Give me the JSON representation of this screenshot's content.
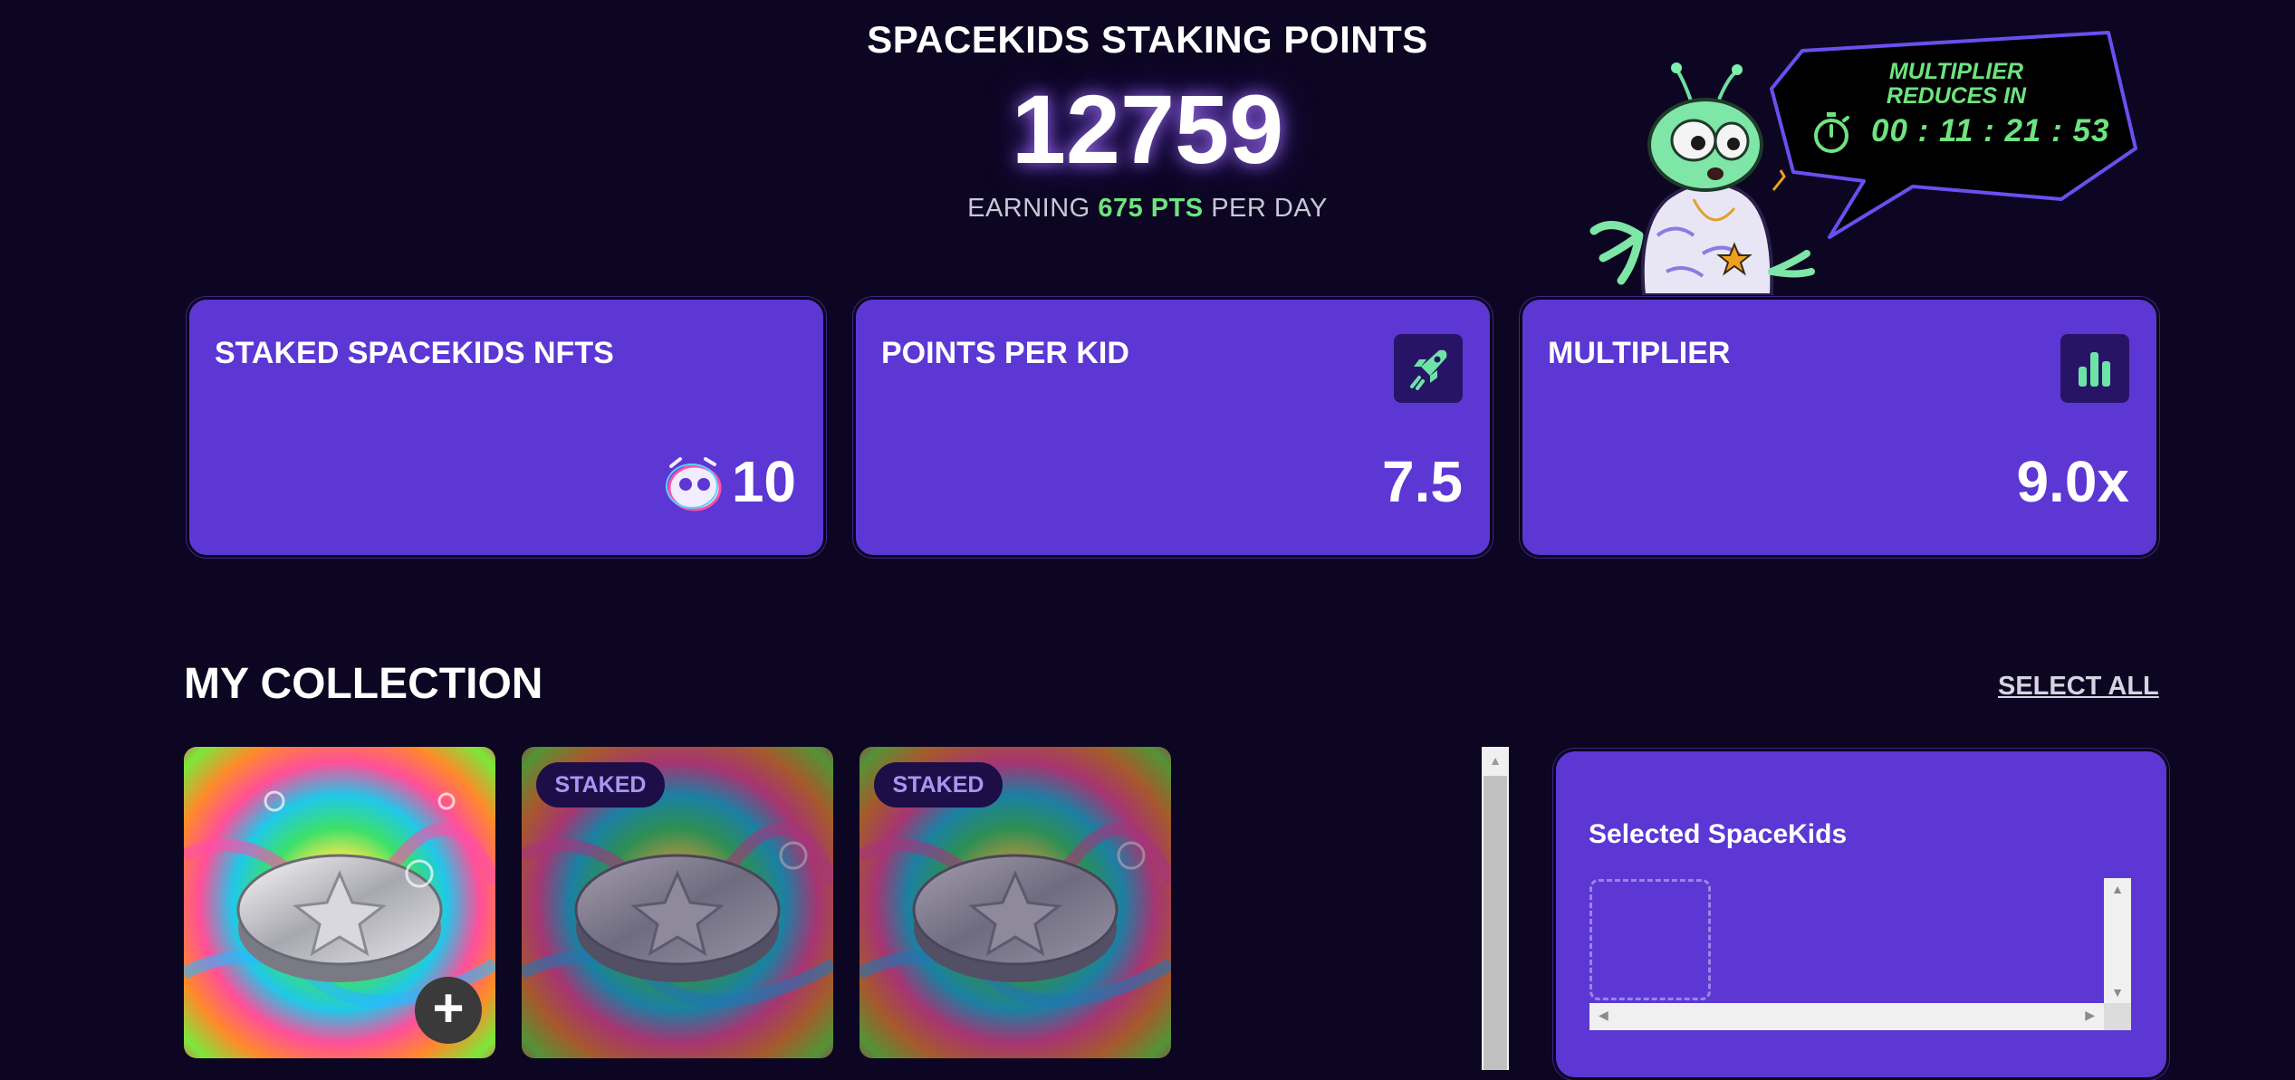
{
  "header": {
    "title": "SPACEKIDS STAKING POINTS",
    "points": "12759",
    "earning_prefix": "EARNING",
    "earning_value": "675 PTS",
    "earning_suffix": "PER DAY"
  },
  "multiplier_banner": {
    "line1": "MULTIPLIER",
    "line2": "REDUCES IN",
    "countdown": "00 : 11 : 21 : 53"
  },
  "cards": [
    {
      "title": "STAKED SPACEKIDS NFTS",
      "value": "10",
      "icon": "spacekid-face-icon"
    },
    {
      "title": "POINTS PER KID",
      "value": "7.5",
      "icon": "rocket-icon"
    },
    {
      "title": "MULTIPLIER",
      "value": "9.0x",
      "icon": "bar-chart-icon"
    }
  ],
  "collection": {
    "title": "MY COLLECTION",
    "select_all": "SELECT ALL",
    "items": [
      {
        "staked": false,
        "badge": ""
      },
      {
        "staked": true,
        "badge": "STAKED"
      },
      {
        "staked": true,
        "badge": "STAKED"
      }
    ]
  },
  "selected_panel": {
    "title": "Selected SpaceKids"
  },
  "colors": {
    "background": "#0c0622",
    "card": "#5c37d4",
    "accent_green": "#6ee37f",
    "badge_bg": "#1d0e47"
  }
}
